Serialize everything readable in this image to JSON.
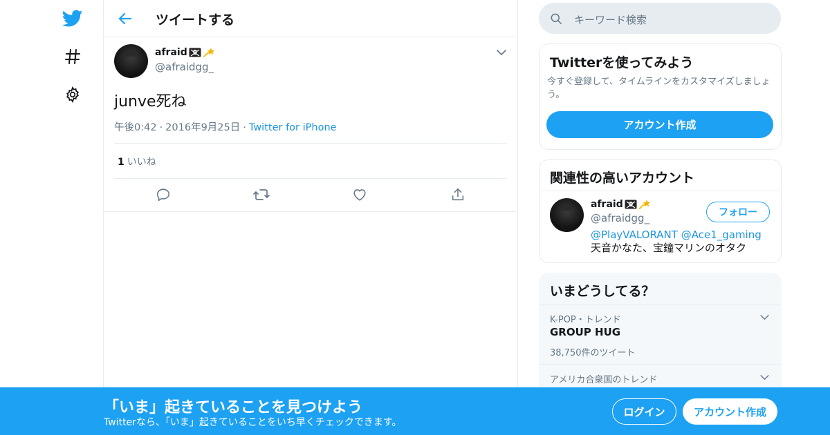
{
  "header": {
    "title": "ツイートする"
  },
  "tweet": {
    "user_name": "afraid",
    "user_handle": "@afraidgg_",
    "text": "junve死ね",
    "time": "午後0:42",
    "date": "2016年9月25日",
    "source": "Twitter for iPhone",
    "like_count": "1",
    "like_label": "いいね"
  },
  "search": {
    "placeholder": "キーワード検索"
  },
  "signup_card": {
    "title": "Twitterを使ってみよう",
    "description": "今すぐ登録して、タイムラインをカスタマイズしましょう。",
    "button": "アカウント作成"
  },
  "related": {
    "title": "関連性の高いアカウント",
    "name": "afraid",
    "handle": "@afraidgg_",
    "follow_label": "フォロー",
    "bio_mention1": "@PlayVALORANT",
    "bio_mention2": "@Ace1_gaming",
    "bio_text": " 天音かなた、宝鐘マリンのオタク"
  },
  "trends": {
    "title": "いまどうしてる？",
    "items": [
      {
        "context": "K-POP・トレンド",
        "name": "GROUP HUG",
        "count": "38,750件のツイート"
      },
      {
        "context": "アメリカ合衆国のトレンド"
      }
    ]
  },
  "bottom_bar": {
    "title": "「いま」起きていることを見つけよう",
    "subtitle": "Twitterなら、「いま」起きていることをいち早くチェックできます。",
    "login": "ログイン",
    "signup": "アカウント作成"
  },
  "colors": {
    "accent": "#1da1f2",
    "link": "#1b95e0",
    "secondary_text": "#657786",
    "border": "#e6ecf0"
  },
  "icons": [
    "twitter-bird-icon",
    "hashtag-icon",
    "gear-icon",
    "back-arrow-icon",
    "chevron-down-icon",
    "reply-icon",
    "retweet-icon",
    "like-icon",
    "share-icon",
    "search-icon",
    "pirate-flag-icon",
    "sparkle-star-icon"
  ]
}
